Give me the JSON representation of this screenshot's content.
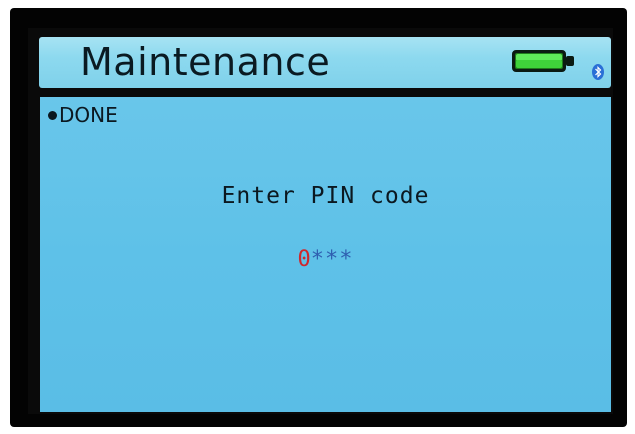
{
  "header": {
    "title": "Maintenance",
    "battery_icon": "battery-full-icon",
    "battery_level": 0.8,
    "bluetooth_icon": "bluetooth-icon"
  },
  "menu": {
    "items": [
      {
        "label": "DONE"
      }
    ]
  },
  "pin_entry": {
    "prompt": "Enter PIN code",
    "current_digit": "0",
    "masked_digits": "***"
  },
  "colors": {
    "title_bar": "#8dd9ef",
    "content_bg": "#5ec1e8",
    "pin_active": "#d0262b",
    "pin_masked": "#2f5fb0",
    "battery_fill": "#3fd23a"
  }
}
